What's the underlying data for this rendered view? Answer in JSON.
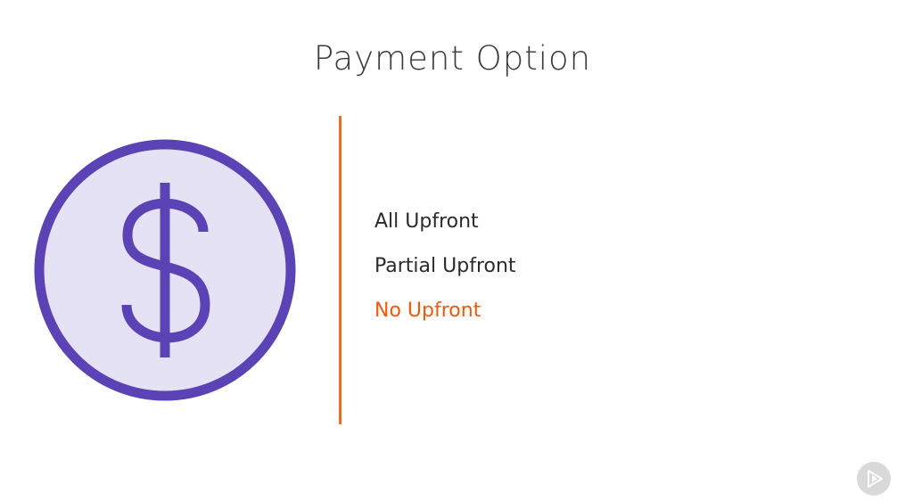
{
  "slide": {
    "title": "Payment Option"
  },
  "options": [
    {
      "label": "All Upfront",
      "selected": false
    },
    {
      "label": "Partial Upfront",
      "selected": false
    },
    {
      "label": "No Upfront",
      "selected": true
    }
  ],
  "colors": {
    "coin_fill": "#e6e2f5",
    "coin_stroke": "#5c43b5",
    "divider": "#e8701e",
    "selected_option": "#f05a0a",
    "option_text": "#2b2b2b",
    "logo": "#d9d9d9"
  },
  "icons": {
    "coin": "dollar-coin-icon",
    "logo": "play-logo-icon"
  }
}
